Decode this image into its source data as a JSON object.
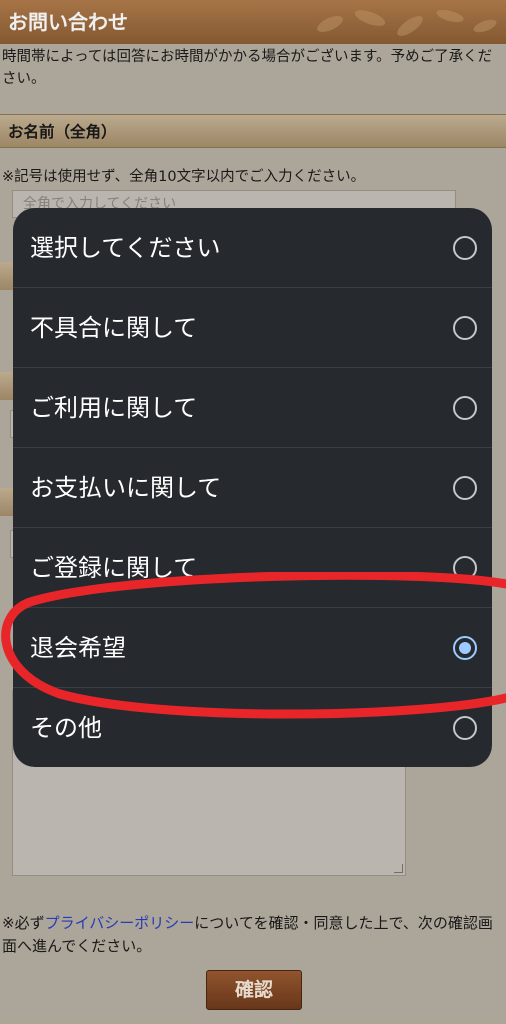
{
  "page": {
    "title": "お問い合わせ",
    "intro": "時間帯によっては回答にお時間がかかる場合がございます。予めご了承ください。",
    "name_section": {
      "heading": "お名前（全角）",
      "note": "※記号は使用せず、全角10文字以内でご入力ください。",
      "placeholder": "全角で入力してください"
    },
    "footer": {
      "prefix": "※必ず",
      "link": "プライバシーポリシー",
      "suffix": "についてを確認・同意した上で、次の確認画面へ進んでください。"
    },
    "confirm_label": "確認"
  },
  "dialog": {
    "options": [
      {
        "label": "選択してください",
        "selected": false
      },
      {
        "label": "不具合に関して",
        "selected": false
      },
      {
        "label": "ご利用に関して",
        "selected": false
      },
      {
        "label": "お支払いに関して",
        "selected": false
      },
      {
        "label": "ご登録に関して",
        "selected": false
      },
      {
        "label": "退会希望",
        "selected": true
      },
      {
        "label": "その他",
        "selected": false
      }
    ]
  },
  "colors": {
    "accent_radio": "#9ecbff",
    "annotation": "#e8262a",
    "header": "#9a6a3e",
    "link": "#2a3fc2"
  }
}
